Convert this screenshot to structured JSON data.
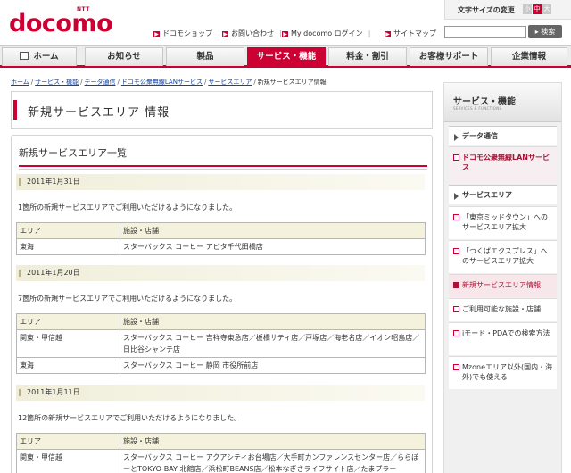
{
  "header": {
    "logo_ntt": "NTT",
    "logo_brand": "docomo",
    "text_size_label": "文字サイズの変更",
    "text_size_small": "小",
    "text_size_medium": "中",
    "text_size_large": "大",
    "links": [
      "ドコモショップ",
      "お問い合わせ",
      "My docomo ログイン",
      "サイトマップ"
    ],
    "search_button": "検索",
    "search_placeholder": ""
  },
  "nav": {
    "items": [
      "ホーム",
      "お知らせ",
      "製品",
      "サービス・機能",
      "料金・割引",
      "お客様サポート",
      "企業情報"
    ],
    "active": "サービス・機能"
  },
  "breadcrumb": {
    "items": [
      "ホーム",
      "サービス・機能",
      "データ通信",
      "ドコモ公衆無線LANサービス",
      "サービスエリア"
    ],
    "current": "新規サービスエリア情報"
  },
  "page_title": "新規サービスエリア 情報",
  "section_title": "新規サービスエリア一覧",
  "table_headers": {
    "area": "エリア",
    "facility": "施設・店舗"
  },
  "entries": [
    {
      "date": "2011年1月31日",
      "note": "1箇所の新規サービスエリアでご利用いただけるようになりました。",
      "rows": [
        {
          "area": "東海",
          "facility": "スターバックス コーヒー アピタ千代田橋店"
        }
      ]
    },
    {
      "date": "2011年1月20日",
      "note": "7箇所の新規サービスエリアでご利用いただけるようになりました。",
      "rows": [
        {
          "area": "関東・甲信越",
          "facility": "スターバックス コーヒー 吉祥寺東急店／板橋サティ店／戸塚店／海老名店／イオン昭島店／日比谷シャンテ店"
        },
        {
          "area": "東海",
          "facility": "スターバックス コーヒー 静岡 市役所前店"
        }
      ]
    },
    {
      "date": "2011年1月11日",
      "note": "12箇所の新規サービスエリアでご利用いただけるようになりました。",
      "rows": [
        {
          "area": "関東・甲信越",
          "facility": "スターバックス コーヒー アクアシティお台場店／大手町カンファレンスセンター店／ららぽーとTOKYO-BAY 北館店／浜松町BEANS店／松本なぎさライフサイト店／たまプラー"
        }
      ]
    }
  ],
  "sidebar": {
    "heading": "サービス・機能",
    "heading_sub": "SERVICES & FUNCTIONS",
    "section_data": "データ通信",
    "item_lan": "ドコモ公衆無線LANサービス",
    "section_area": "サービスエリア",
    "items": [
      "「東京ミッドタウン」へのサービスエリア拡大",
      "「つくばエクスプレス」へのサービスエリア拡大",
      "新規サービスエリア情報",
      "ご利用可能な施設・店舗",
      "iモード・PDAでの検索方法",
      "Mzoneエリア以外(国内・海外)でも使える"
    ]
  }
}
